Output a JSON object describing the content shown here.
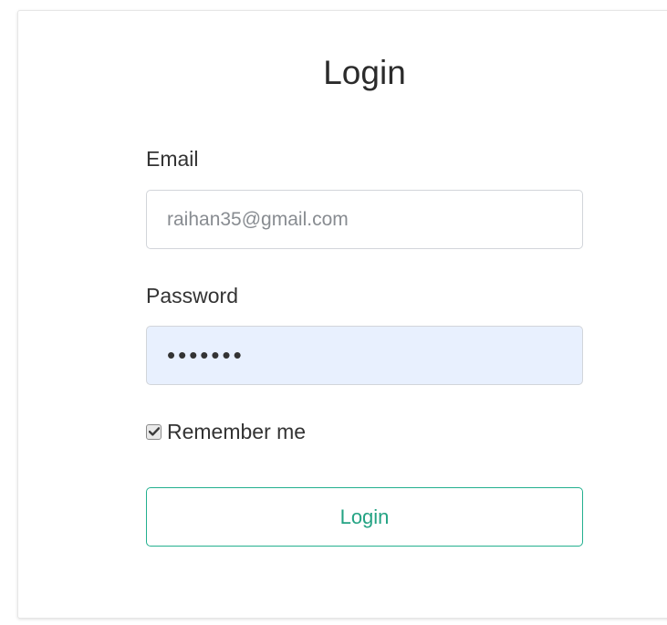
{
  "form": {
    "title": "Login",
    "email_label": "Email",
    "email_placeholder": "raihan35@gmail.com",
    "email_value": "",
    "password_label": "Password",
    "password_value": "•••••••",
    "remember_label": "Remember me",
    "remember_checked": true,
    "submit_label": "Login"
  },
  "colors": {
    "accent": "#23b08f",
    "autofill_bg": "#e8f0fe"
  },
  "icons": {
    "checkbox_mark": "check-icon"
  }
}
